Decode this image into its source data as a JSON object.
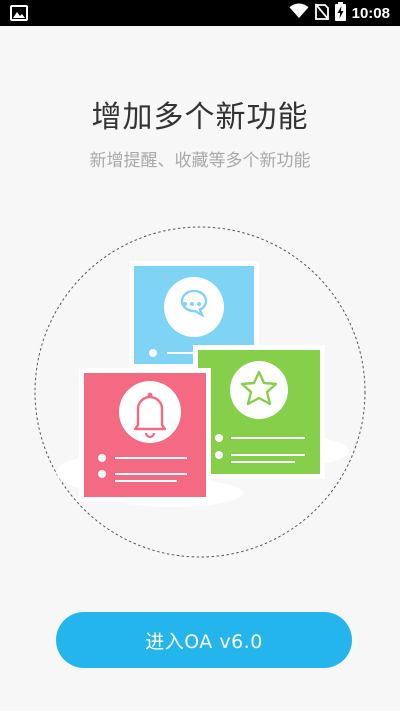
{
  "status_bar": {
    "time": "10:08",
    "icons": [
      "image-icon",
      "wifi-icon",
      "no-sim-icon",
      "battery-charging-icon"
    ]
  },
  "intro": {
    "title": "增加多个新功能",
    "subtitle": "新增提醒、收藏等多个新功能"
  },
  "illustration": {
    "cards": [
      {
        "name": "chat-card",
        "icon": "chat-bubble-icon",
        "color": "#7fd3f5"
      },
      {
        "name": "star-card",
        "icon": "star-icon",
        "color": "#86cf4a"
      },
      {
        "name": "bell-card",
        "icon": "bell-icon",
        "color": "#f36a82"
      }
    ]
  },
  "action": {
    "enter_label": "进入OA v6.0",
    "color": "#23b5eb"
  }
}
